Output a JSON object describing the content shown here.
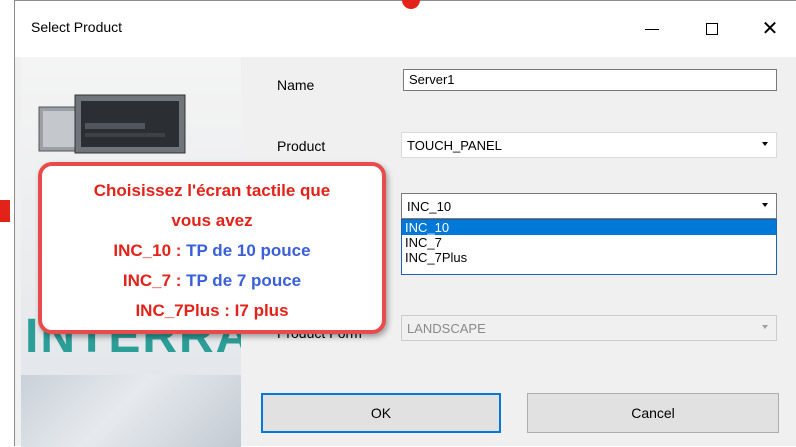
{
  "window": {
    "title": "Select Product",
    "close_glyph": "✕"
  },
  "hero": {
    "brand_text": "INTERRA"
  },
  "form": {
    "name_label": "Name",
    "name_value": "Server1",
    "product_label": "Product",
    "product_value": "TOUCH_PANEL",
    "model_value": "INC_10",
    "model_options": [
      "INC_10",
      "INC_7",
      "INC_7Plus"
    ],
    "form_label": "Product Form",
    "form_value": "LANDSCAPE"
  },
  "buttons": {
    "ok": "OK",
    "cancel": "Cancel"
  },
  "callout": {
    "line1": "Choisissez l'écran tactile que",
    "line2": "vous avez",
    "line3_key": "INC_10 :",
    "line3_val": "TP de 10 pouce",
    "line4_key": "INC_7 :",
    "line4_val": "TP de 7 pouce",
    "line5_key": "INC_7Plus :",
    "line5_val": "I7 plus"
  },
  "colors": {
    "callout_border": "#e84b4b",
    "callout_red": "#e32219",
    "callout_blue": "#3a5fd9",
    "selection": "#0078d7",
    "brand": "#2c9e98"
  },
  "icons": [
    "minimize-icon",
    "maximize-icon",
    "close-icon",
    "chevron-down-icon"
  ]
}
